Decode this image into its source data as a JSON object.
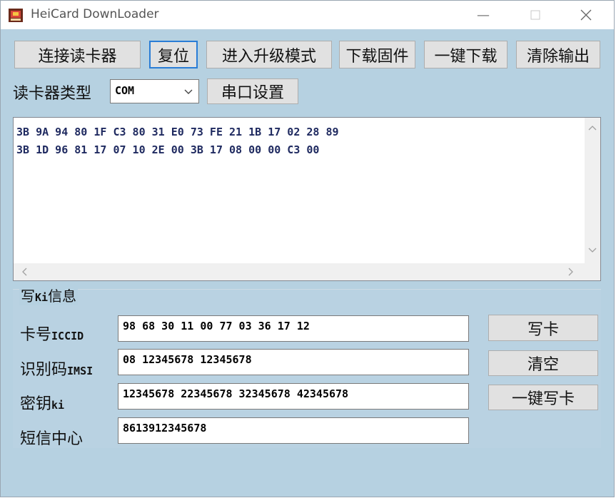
{
  "window": {
    "title": "HeiCard DownLoader",
    "icon": "app-icon",
    "controls": [
      "minimize-icon",
      "maximize-icon",
      "close-icon"
    ]
  },
  "toolbar": {
    "connect": "连接读卡器",
    "reset": "复位",
    "upgrade_mode": "进入升级模式",
    "download_firmware": "下载固件",
    "one_click_download": "一键下载",
    "clear_output": "清除输出"
  },
  "reader": {
    "type_label": "读卡器类型",
    "type_value": "COM",
    "serial_settings": "串口设置"
  },
  "output": {
    "lines": [
      "3B 9A 94 80 1F C3 80 31 E0 73 FE 21 1B 17 02 28 89",
      "3B 1D 96 81 17 07 10 2E 00 3B 17 08 00 00 C3 00"
    ]
  },
  "ki_group": {
    "title_prefix": "写",
    "title_ki": "Ki",
    "title_suffix": "信息",
    "iccid_label_cn": "卡号",
    "iccid_label_en": "ICCID",
    "iccid_value": "98 68 30 11 00 77 03 36 17 12",
    "imsi_label_cn": "识别码",
    "imsi_label_en": "IMSI",
    "imsi_value": "08 12345678 12345678",
    "ki_label_cn": "密钥",
    "ki_label_en": "ki",
    "ki_value": "12345678 22345678 32345678 42345678",
    "smsc_label": "短信中心",
    "smsc_value": "8613912345678",
    "write_card": "写卡",
    "clear": "清空",
    "one_click_write": "一键写卡"
  }
}
